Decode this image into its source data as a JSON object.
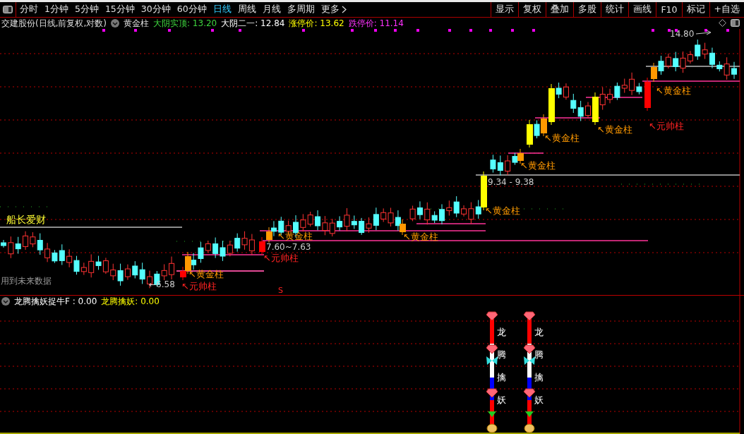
{
  "toolbar": {
    "tabs": [
      {
        "label": "分时",
        "selected": false
      },
      {
        "label": "1分钟",
        "selected": false
      },
      {
        "label": "5分钟",
        "selected": false
      },
      {
        "label": "15分钟",
        "selected": false
      },
      {
        "label": "30分钟",
        "selected": false
      },
      {
        "label": "60分钟",
        "selected": false
      },
      {
        "label": "日线",
        "selected": true
      },
      {
        "label": "周线",
        "selected": false
      },
      {
        "label": "月线",
        "selected": false
      },
      {
        "label": "多周期",
        "selected": false
      },
      {
        "label": "更多",
        "selected": false
      }
    ],
    "buttons": [
      "显示",
      "复权",
      "叠加",
      "多股",
      "统计",
      "画线",
      "F10",
      "标记",
      "+自选"
    ]
  },
  "chart_header": {
    "title": "交建股份(日线,前复权,对数)",
    "indicator": "黄金柱",
    "values": [
      {
        "label": "大阴实顶:",
        "value": "13.20",
        "color": "#3ed43e"
      },
      {
        "label": "大阴二一:",
        "value": "12.84",
        "color": "#ffffff"
      },
      {
        "label": "涨停价:",
        "value": "13.62",
        "color": "#ffff00"
      },
      {
        "label": "跌停价:",
        "value": "11.14",
        "color": "#ff33ff"
      }
    ]
  },
  "main_chart": {
    "annotations": [
      {
        "kind": "brand",
        "text": "船长爱财"
      },
      {
        "kind": "note",
        "text": "用到未来数据"
      },
      {
        "kind": "price",
        "text": "←6.58"
      },
      {
        "kind": "signal",
        "text": "↖黄金柱"
      },
      {
        "kind": "marshal",
        "text": "↖元帅柱"
      },
      {
        "kind": "signal",
        "text": "↖黄金柱"
      },
      {
        "kind": "range",
        "text": "7.60~7.63"
      },
      {
        "kind": "marshal",
        "text": "↖元帅柱"
      },
      {
        "kind": "signal",
        "text": "↖黄金柱"
      },
      {
        "kind": "signal",
        "text": "↖黄金柱"
      },
      {
        "kind": "range",
        "text": "9.34 - 9.38"
      },
      {
        "kind": "signal",
        "text": "↖黄金柱"
      },
      {
        "kind": "signal",
        "text": "↖黄金柱"
      },
      {
        "kind": "signal",
        "text": "↖黄金柱"
      },
      {
        "kind": "signal",
        "text": "↖黄金柱"
      },
      {
        "kind": "marshal",
        "text": "↖元帅柱"
      },
      {
        "kind": "price",
        "text": "14.80"
      },
      {
        "kind": "s-mark",
        "text": "S"
      }
    ]
  },
  "indicator_panel": {
    "values": [
      {
        "text": "龙腾擒妖捉牛F : 0.00",
        "color": "#ffffff"
      },
      {
        "text": "龙腾擒妖: 0.00",
        "color": "#ffff00"
      }
    ],
    "columns": [
      {
        "chars": [
          "龙",
          "腾",
          "擒",
          "妖"
        ]
      },
      {
        "chars": [
          "龙",
          "腾",
          "擒",
          "妖"
        ]
      }
    ]
  }
}
